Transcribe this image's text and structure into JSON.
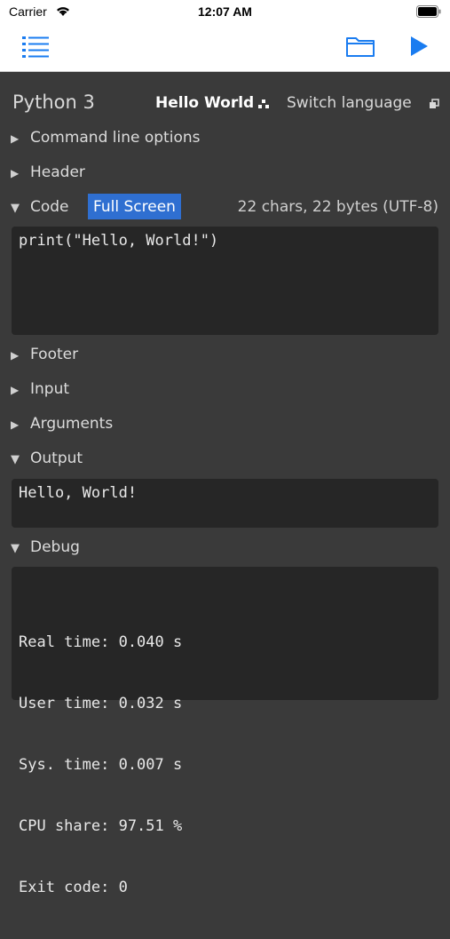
{
  "status_bar": {
    "carrier": "Carrier",
    "time": "12:07 AM"
  },
  "nav": {
    "list_icon": "list-icon",
    "folder_icon": "folder-icon",
    "run_icon": "play-icon",
    "accent": "#1a7cf0"
  },
  "header": {
    "language": "Python 3",
    "title_button": "Hello World",
    "switch_language": "Switch language"
  },
  "sections": {
    "command_line": "Command line options",
    "header": "Header",
    "code": "Code",
    "full_screen": "Full Screen",
    "char_count": "22 chars, 22 bytes (UTF-8)",
    "footer": "Footer",
    "input": "Input",
    "arguments": "Arguments",
    "output": "Output",
    "debug": "Debug"
  },
  "code": {
    "text": "print(\"Hello, World!\")"
  },
  "output": {
    "text": "Hello, World!"
  },
  "debug": {
    "lines": [
      "Real time: 0.040 s",
      "User time: 0.032 s",
      "Sys. time: 0.007 s",
      "CPU share: 97.51 %",
      "Exit code: 0"
    ]
  },
  "colors": {
    "background": "#3a3a3a",
    "panel": "#262626",
    "highlight": "#2f6fd1"
  }
}
